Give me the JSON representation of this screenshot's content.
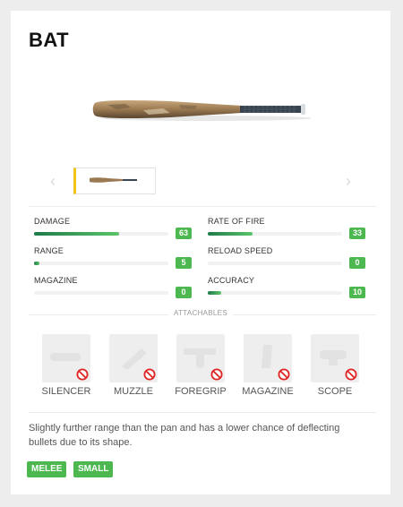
{
  "item": {
    "name": "BAT",
    "description": "Slightly further range than the pan and has a lower chance of deflecting bullets due to its shape."
  },
  "gallery": {
    "prev_icon": "chevron-left-icon",
    "next_icon": "chevron-right-icon",
    "thumbnails": [
      {
        "selected": true
      }
    ]
  },
  "stats": [
    {
      "label": "DAMAGE",
      "value": "63",
      "fill_fraction": 0.63
    },
    {
      "label": "RATE OF FIRE",
      "value": "33",
      "fill_fraction": 0.33
    },
    {
      "label": "RANGE",
      "value": "5",
      "fill_fraction": 0.04
    },
    {
      "label": "RELOAD SPEED",
      "value": "0",
      "fill_fraction": 0.0
    },
    {
      "label": "MAGAZINE",
      "value": "0",
      "fill_fraction": 0.0
    },
    {
      "label": "ACCURACY",
      "value": "10",
      "fill_fraction": 0.1
    }
  ],
  "attachables": {
    "label": "ATTACHABLES",
    "items": [
      {
        "name": "SILENCER",
        "icon": "silencer-icon",
        "status_icon": "prohibited-icon"
      },
      {
        "name": "MUZZLE",
        "icon": "muzzle-icon",
        "status_icon": "prohibited-icon"
      },
      {
        "name": "FOREGRIP",
        "icon": "foregrip-icon",
        "status_icon": "prohibited-icon"
      },
      {
        "name": "MAGAZINE",
        "icon": "magazine-icon",
        "status_icon": "prohibited-icon"
      },
      {
        "name": "SCOPE",
        "icon": "scope-icon",
        "status_icon": "prohibited-icon"
      }
    ]
  },
  "tags": [
    "MELEE",
    "SMALL"
  ],
  "colors": {
    "accent_green": "#4cb84f",
    "bar_gradient_start": "#1f7a4a",
    "bar_gradient_end": "#5cc46a",
    "thumbnail_selected": "#f0c419",
    "prohibited_red": "#e02424"
  }
}
